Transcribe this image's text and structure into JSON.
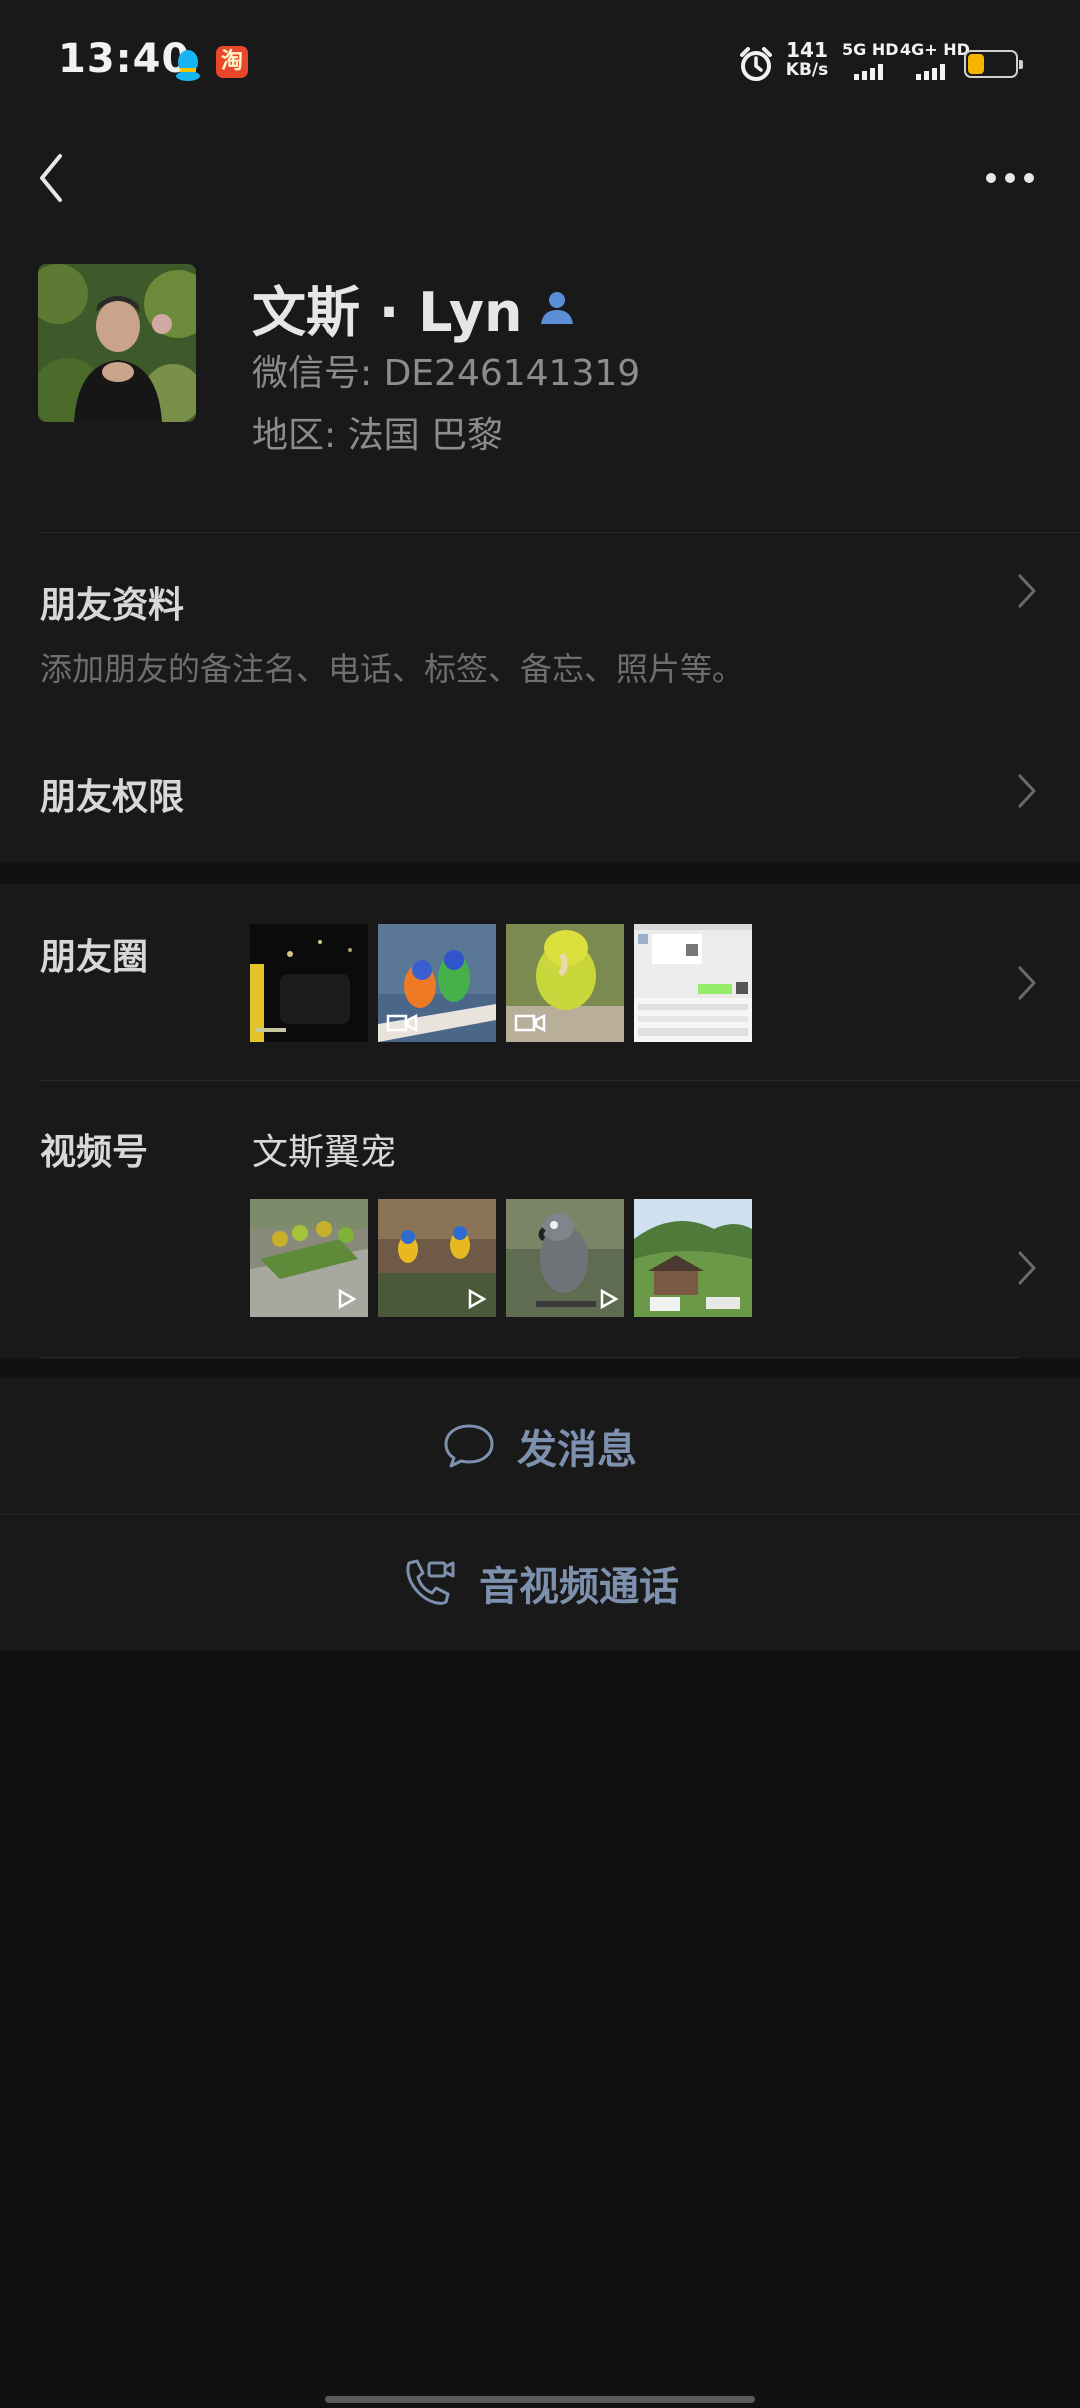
{
  "status_bar": {
    "time": "13:40",
    "net_speed_value": "141",
    "net_speed_unit": "KB/s",
    "sim1_label": "5G HD",
    "sim2_label": "4G+ HD",
    "battery_level": 0.35,
    "battery_color": "#f5b400",
    "icons": [
      "qq-icon",
      "taobao-icon",
      "alarm-icon",
      "signal-icon",
      "battery-icon"
    ]
  },
  "profile": {
    "name": "文斯 · Lyn",
    "wechat_id": "微信号:  DE246141319",
    "region": "地区:  法国  巴黎"
  },
  "friend_info": {
    "title": "朋友资料",
    "subtitle": "添加朋友的备注名、电话、标签、备忘、照片等。"
  },
  "friend_permission": {
    "title": "朋友权限"
  },
  "moments": {
    "title": "朋友圈",
    "thumbnails": 4
  },
  "channels": {
    "title": "视频号",
    "name": "文斯翼宠",
    "thumbnails": 4
  },
  "actions": {
    "message": "发消息",
    "call": "音视频通话"
  },
  "colors": {
    "background": "#111111",
    "card": "#191919",
    "accent_text": "#7d90ad",
    "verified_icon": "#5a8fd8"
  }
}
